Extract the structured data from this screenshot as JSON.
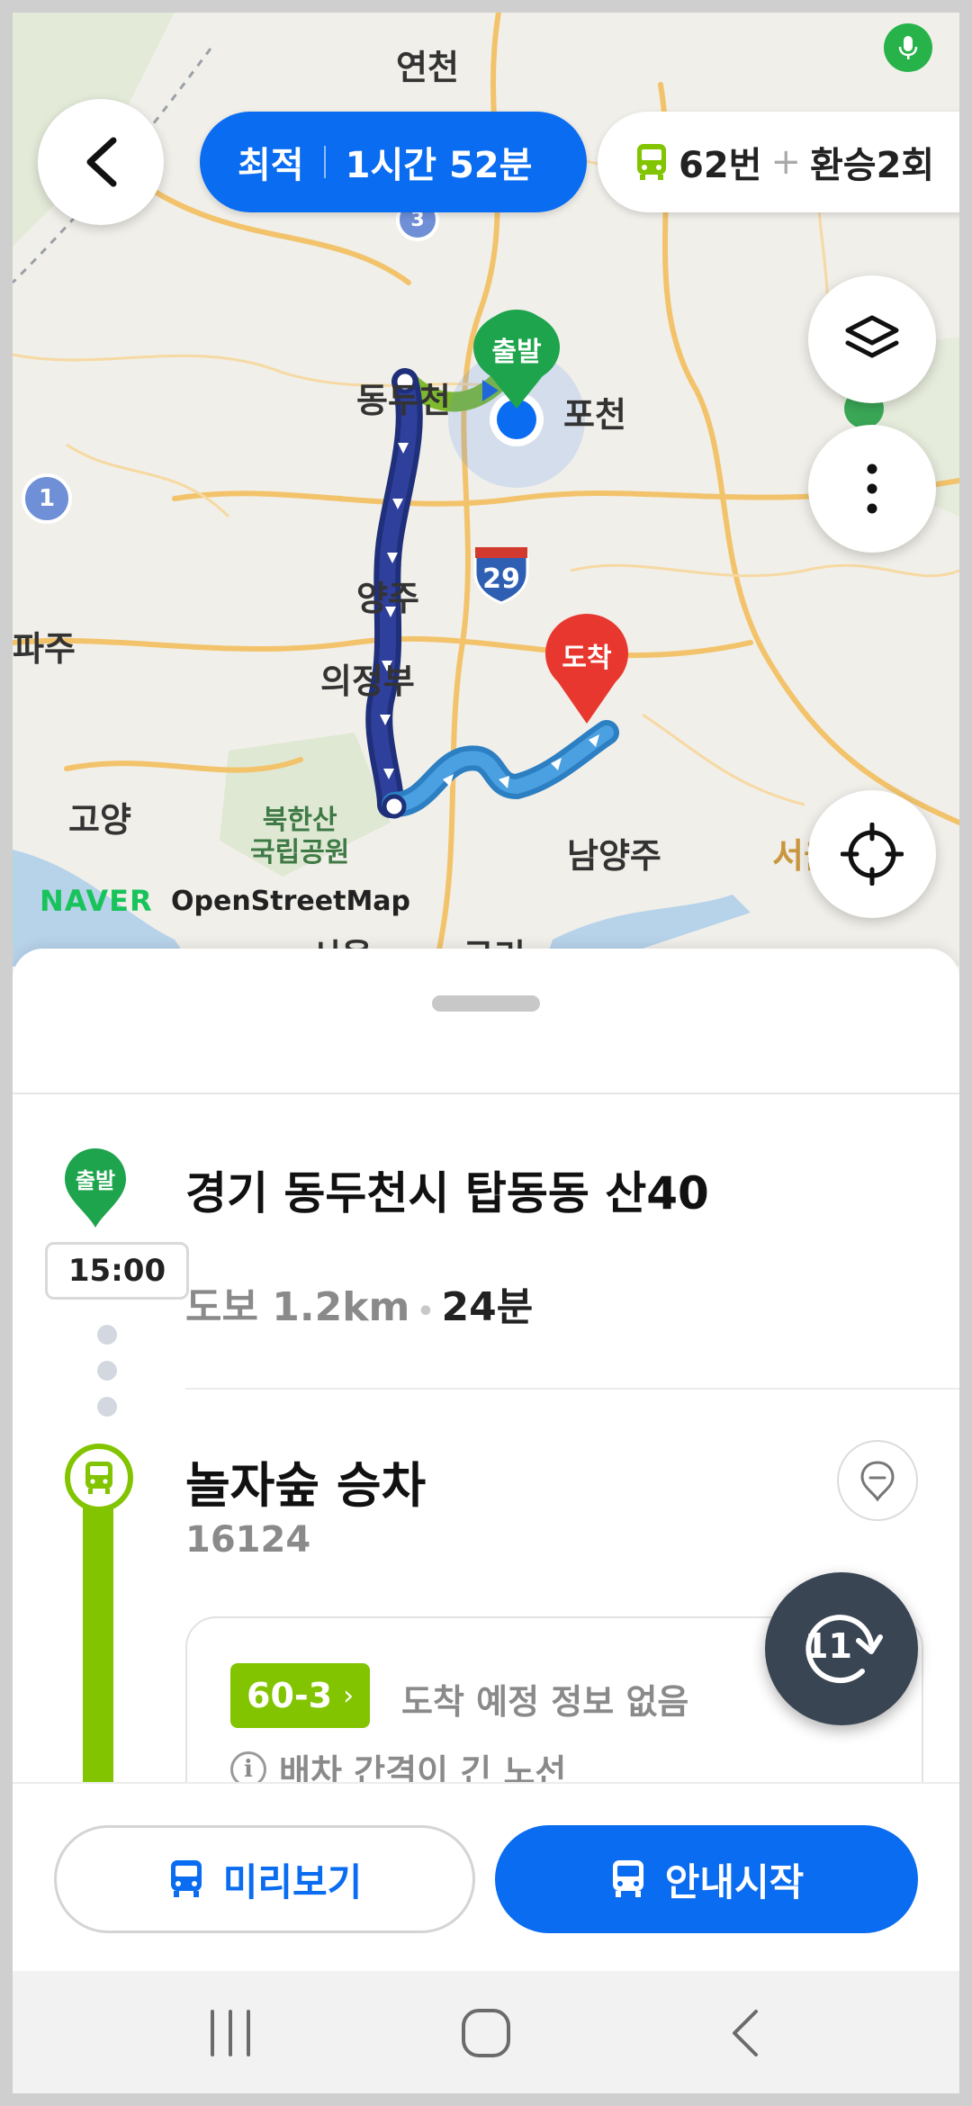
{
  "map": {
    "places": [
      "연천",
      "동두천",
      "포천",
      "양주",
      "의정부",
      "파주",
      "고양",
      "남양주",
      "서울",
      "구리",
      "서울"
    ],
    "park": "북한산\n국립공원",
    "shields": [
      "1",
      "3"
    ],
    "highway": "29",
    "start_marker": "출발",
    "end_marker": "도착",
    "attribution_naver": "NAVER",
    "attribution_osm": "OpenStreetMap",
    "colors": {
      "accent": "#0a6cf0",
      "bus_green": "#82c400",
      "walk_route": "#1f2f7a",
      "bus_route": "#3b8fd0"
    }
  },
  "header": {
    "back_icon": "chevron-left-icon",
    "route_type": "최적",
    "duration": "1시간 52분",
    "bus_summary": "62번",
    "transfer_summary": "환승2회"
  },
  "fabs": {
    "layers_icon": "layers-icon",
    "more_icon": "more-vertical-icon",
    "locate_icon": "crosshair-icon"
  },
  "sheet": {
    "start_marker": "출발",
    "start_time": "15:00",
    "start_address": "경기 동두천시 탑동동 산40",
    "walk_label": "도보 1.2km",
    "walk_duration": "24분",
    "stop_name": "놀자숲 승차",
    "stop_id": "16124",
    "route_number": "60-3",
    "arrival_info": "도착 예정 정보 없음",
    "interval_info": "배차 간격이 긴 노선",
    "refresh_count": "11"
  },
  "actions": {
    "preview": "미리보기",
    "start_guide": "안내시작"
  },
  "navbar": {
    "recent_icon": "recent-apps-icon",
    "home_icon": "home-icon",
    "back_icon": "back-icon"
  }
}
